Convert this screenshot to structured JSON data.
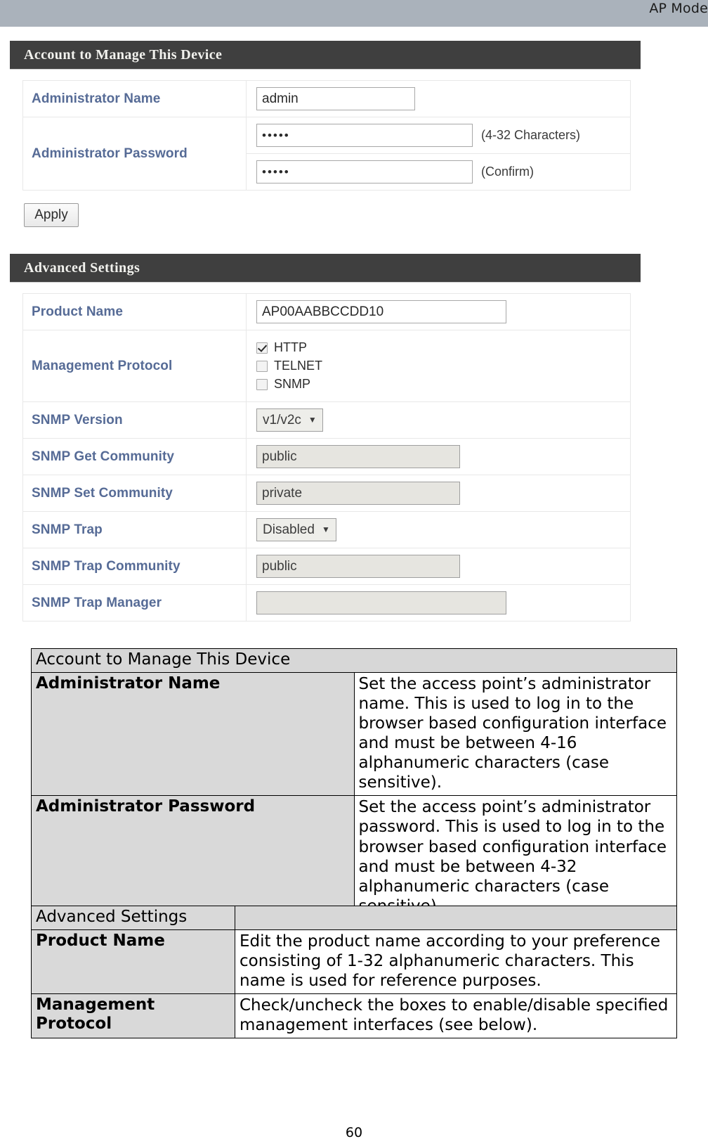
{
  "top_bar": {
    "mode_label": "AP Mode"
  },
  "panel_one": {
    "header": "Account to Manage This Device",
    "rows": [
      {
        "label": "Administrator Name",
        "value": "admin"
      },
      {
        "label": "Administrator Password",
        "value_primary": "•••••",
        "hint_primary": "(4-32 Characters)",
        "value_confirm": "•••••",
        "hint_confirm": "(Confirm)"
      }
    ],
    "apply_label": "Apply"
  },
  "panel_two": {
    "header": "Advanced Settings",
    "product_name": {
      "label": "Product Name",
      "value": "AP00AABBCCDD10"
    },
    "management_protocol": {
      "label": "Management Protocol",
      "options": [
        {
          "name": "HTTP",
          "checked": true
        },
        {
          "name": "TELNET",
          "checked": false
        },
        {
          "name": "SNMP",
          "checked": false
        }
      ]
    },
    "snmp_version": {
      "label": "SNMP Version",
      "value": "v1/v2c"
    },
    "snmp_get_community": {
      "label": "SNMP Get Community",
      "value": "public"
    },
    "snmp_set_community": {
      "label": "SNMP Set Community",
      "value": "private"
    },
    "snmp_trap": {
      "label": "SNMP Trap",
      "value": "Disabled"
    },
    "snmp_trap_community": {
      "label": "SNMP Trap Community",
      "value": "public"
    },
    "snmp_trap_manager": {
      "label": "SNMP Trap Manager",
      "value": ""
    },
    "caret_glyph": "▼"
  },
  "doc_table_one": {
    "header": "Account to Manage This Device",
    "rows": [
      {
        "key": "Administrator Name",
        "value": "Set the access point’s administrator name. This is used to log in to the browser based configuration interface and must be between 4-16 alphanumeric characters (case sensitive)."
      },
      {
        "key": "Administrator Password",
        "value": "Set the access point’s administrator password. This is used to log in to the browser based configuration interface and must be between 4-32 alphanumeric characters (case sensitive)."
      }
    ]
  },
  "doc_table_two": {
    "header": "Advanced Settings",
    "header_second_cell": "",
    "rows": [
      {
        "key": "Product Name",
        "value": "Edit the product name according to your preference consisting of 1-32 alphanumeric characters. This name is used for reference purposes."
      },
      {
        "key": "Management Protocol",
        "value": "Check/uncheck the boxes to enable/disable specified management interfaces (see below)."
      }
    ]
  },
  "footer": {
    "page_number": "60"
  }
}
